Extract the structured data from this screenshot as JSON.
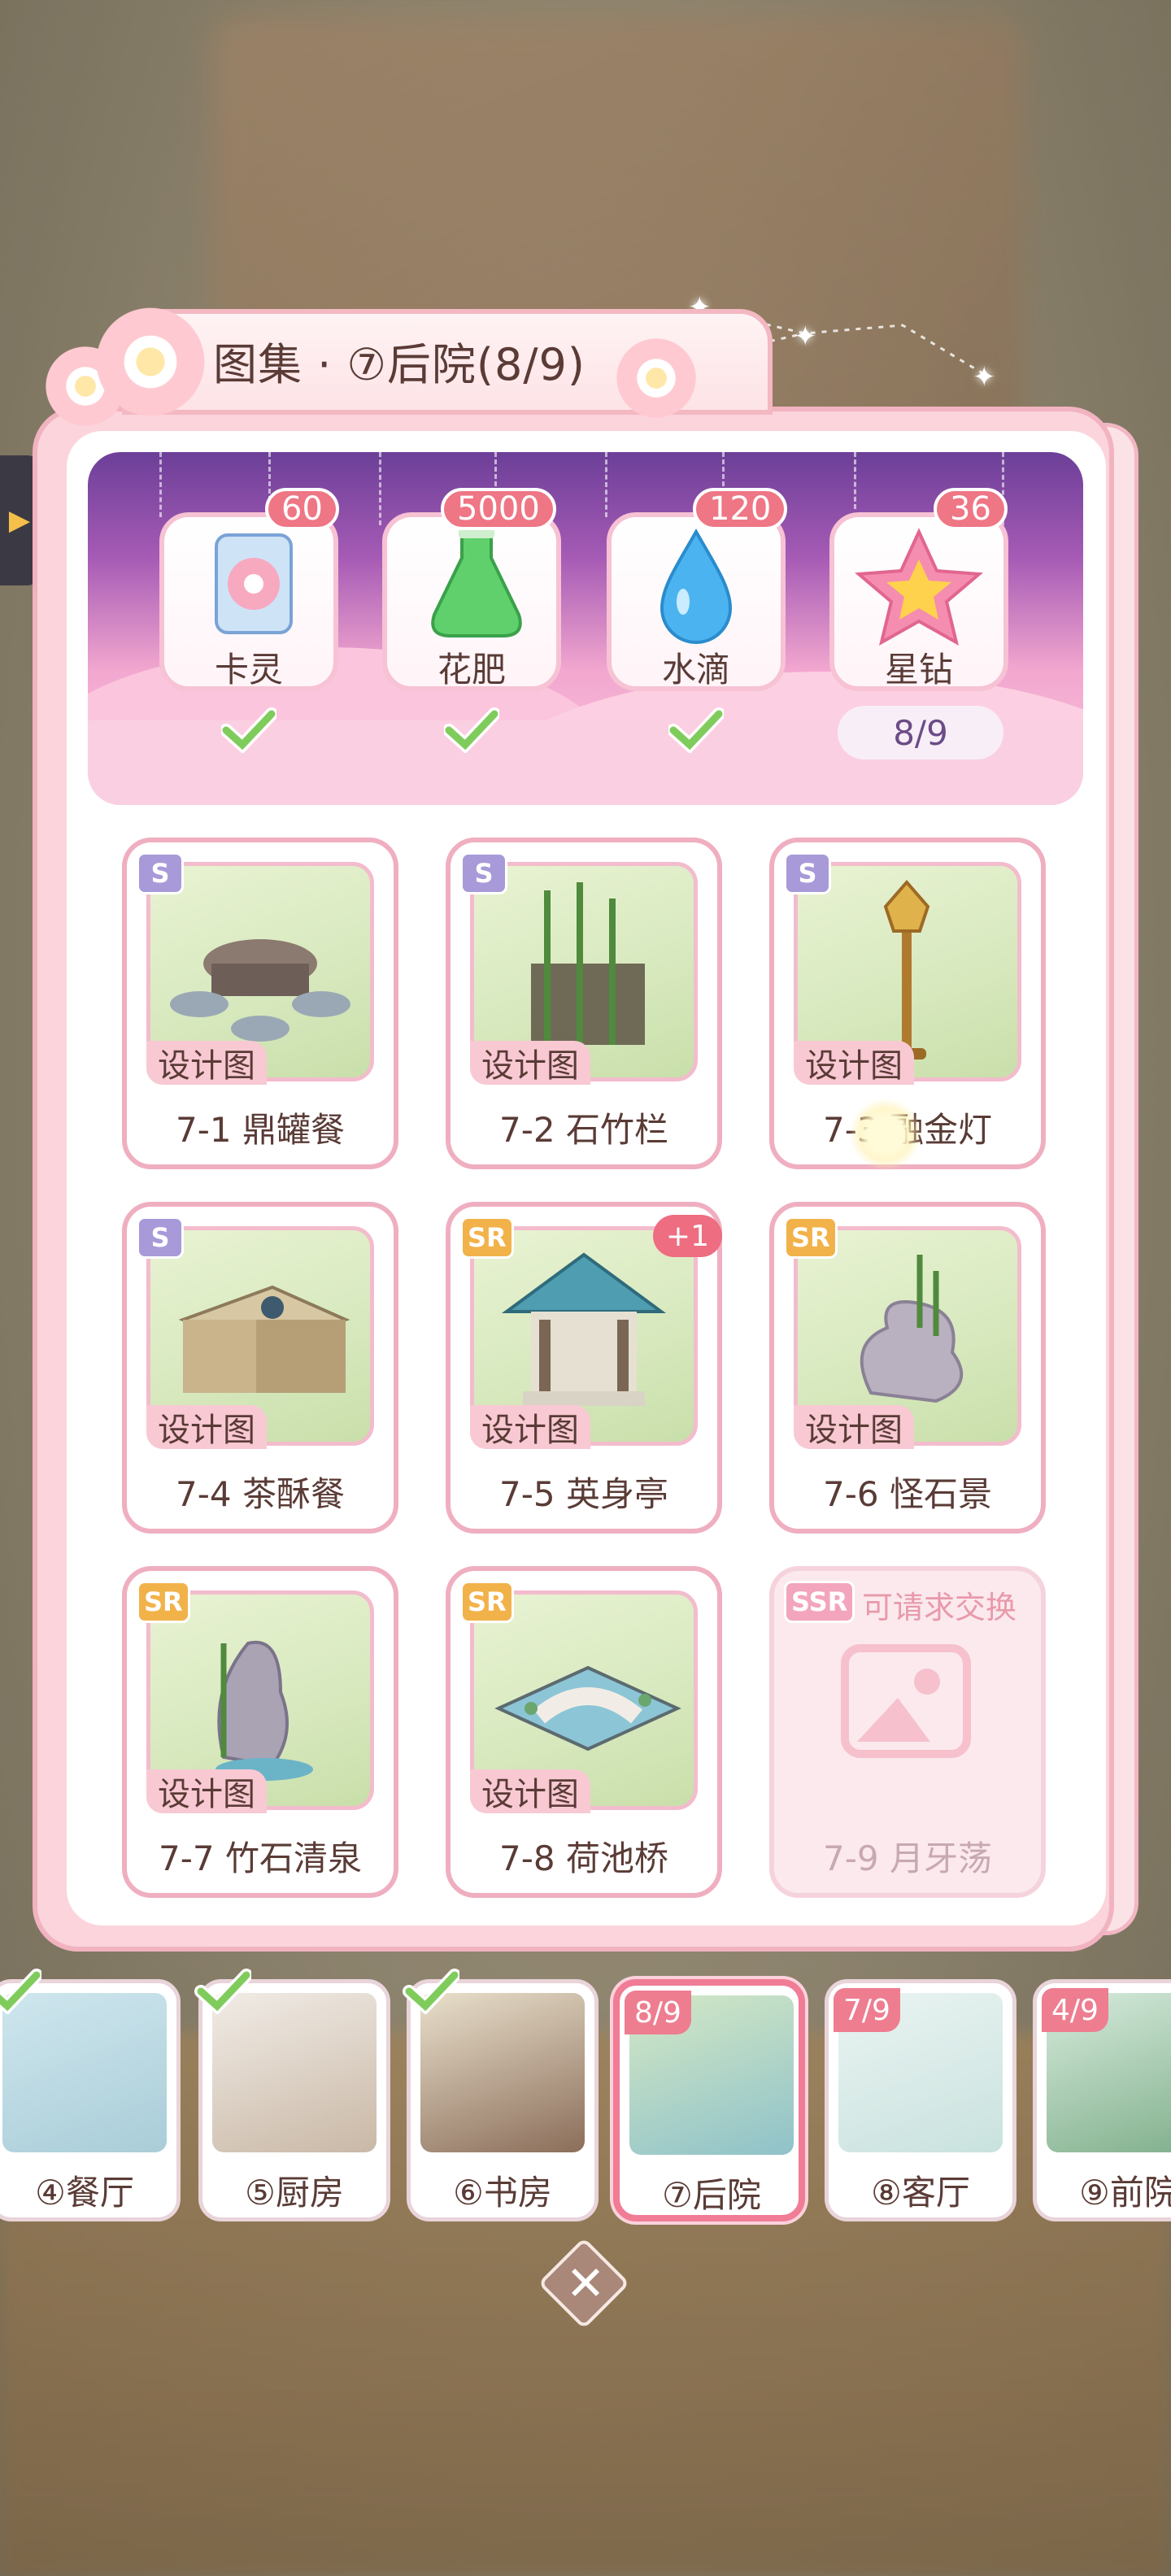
{
  "window": {
    "title": "图集 · ⑦后院(8/9)"
  },
  "resources": [
    {
      "name": "卡灵",
      "count": "60",
      "icon": "card-spirit-icon",
      "complete": true
    },
    {
      "name": "花肥",
      "count": "5000",
      "icon": "fertilizer-flask-icon",
      "complete": true
    },
    {
      "name": "水滴",
      "count": "120",
      "icon": "water-drop-icon",
      "complete": true
    },
    {
      "name": "星钻",
      "count": "36",
      "icon": "star-diamond-icon",
      "complete": false,
      "progress": "8/9"
    }
  ],
  "items": [
    {
      "rarity": "S",
      "tag": "设计图",
      "name": "7-1 鼎罐餐",
      "icon": "round-table-stools-icon"
    },
    {
      "rarity": "S",
      "tag": "设计图",
      "name": "7-2 石竹栏",
      "icon": "bamboo-fence-icon"
    },
    {
      "rarity": "S",
      "tag": "设计图",
      "name": "7-3 融金灯",
      "icon": "golden-lamp-icon"
    },
    {
      "rarity": "S",
      "tag": "设计图",
      "name": "7-4 茶酥餐",
      "icon": "tea-table-icon"
    },
    {
      "rarity": "SR",
      "tag": "设计图",
      "name": "7-5 英身亭",
      "icon": "pavilion-icon",
      "plus": "+1"
    },
    {
      "rarity": "SR",
      "tag": "设计图",
      "name": "7-6 怪石景",
      "icon": "rock-scenery-icon"
    },
    {
      "rarity": "SR",
      "tag": "设计图",
      "name": "7-7 竹石清泉",
      "icon": "bamboo-rock-spring-icon"
    },
    {
      "rarity": "SR",
      "tag": "设计图",
      "name": "7-8 荷池桥",
      "icon": "lotus-pond-bridge-icon"
    },
    {
      "rarity": "SSR",
      "locked": true,
      "exchange": "可请求交换",
      "name": "7-9 月牙荡",
      "icon": "image-placeholder-icon"
    }
  ],
  "rooms": [
    {
      "label": "④餐厅",
      "completed": true
    },
    {
      "label": "⑤厨房",
      "completed": true
    },
    {
      "label": "⑥书房",
      "completed": true
    },
    {
      "label": "⑦后院",
      "progress": "8/9",
      "active": true
    },
    {
      "label": "⑧客厅",
      "progress": "7/9"
    },
    {
      "label": "⑨前院",
      "progress": "4/9"
    }
  ],
  "colors": {
    "accent": "#ee7685",
    "panel": "#fbd4dc",
    "banner_top": "#6c3f98"
  }
}
